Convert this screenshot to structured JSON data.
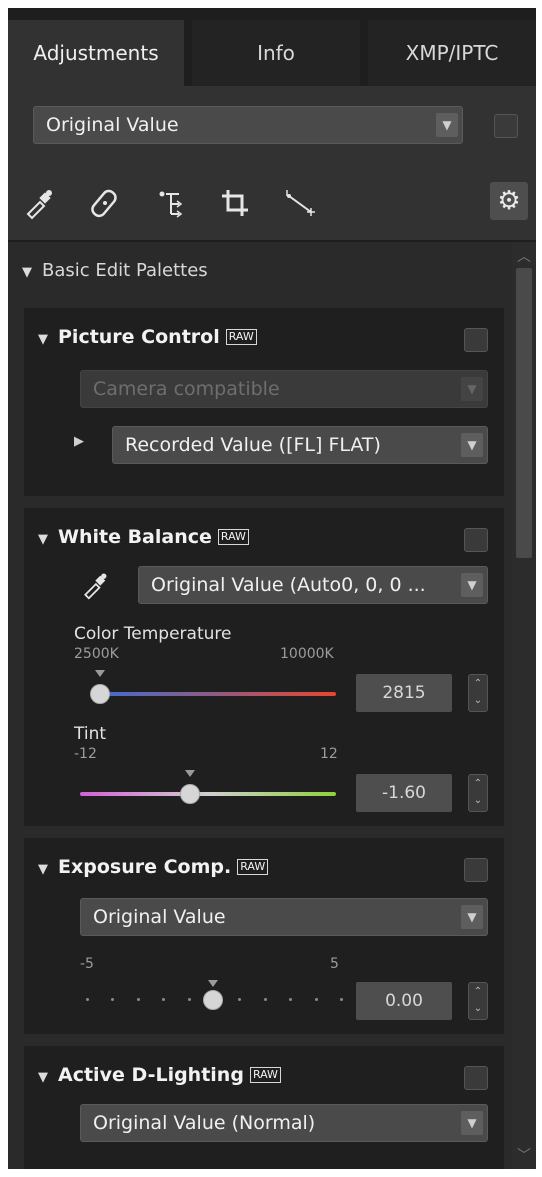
{
  "tabs": [
    {
      "label": "Adjustments",
      "active": true
    },
    {
      "label": "Info",
      "active": false
    },
    {
      "label": "XMP/IPTC",
      "active": false
    }
  ],
  "preset_select": {
    "value": "Original Value"
  },
  "tools": [
    "eyedropper-icon",
    "bandage-icon",
    "control-point-icon",
    "crop-icon",
    "straighten-icon",
    "gear-icon"
  ],
  "group": {
    "label": "Basic Edit Palettes"
  },
  "picture_control": {
    "title": "Picture Control",
    "raw_badge": "RAW",
    "mode": "Camera compatible",
    "value": "Recorded Value ([FL] FLAT)"
  },
  "white_balance": {
    "title": "White Balance",
    "raw_badge": "RAW",
    "value": "Original Value (Auto0, 0, 0 ...",
    "color_temperature": {
      "label": "Color Temperature",
      "min_label": "2500K",
      "max_label": "10000K",
      "value": "2815",
      "position": 0.04
    },
    "tint": {
      "label": "Tint",
      "min_label": "-12",
      "max_label": "12",
      "value": "-1.60",
      "position": 0.43
    }
  },
  "exposure_comp": {
    "title": "Exposure Comp.",
    "raw_badge": "RAW",
    "value": "Original Value",
    "min_label": "-5",
    "max_label": "5",
    "slider_value": "0.00",
    "position": 0.5
  },
  "active_d_lighting": {
    "title": "Active D-Lighting",
    "raw_badge": "RAW",
    "value": "Original Value (Normal)"
  },
  "colors": {
    "background": "#2b2b2b",
    "panel": "#1f1f1f",
    "temp_gradient_start": "#3a6fd8",
    "temp_gradient_end": "#e8462f",
    "tint_gradient_start": "#d65fd6",
    "tint_gradient_end": "#8fd13a"
  }
}
